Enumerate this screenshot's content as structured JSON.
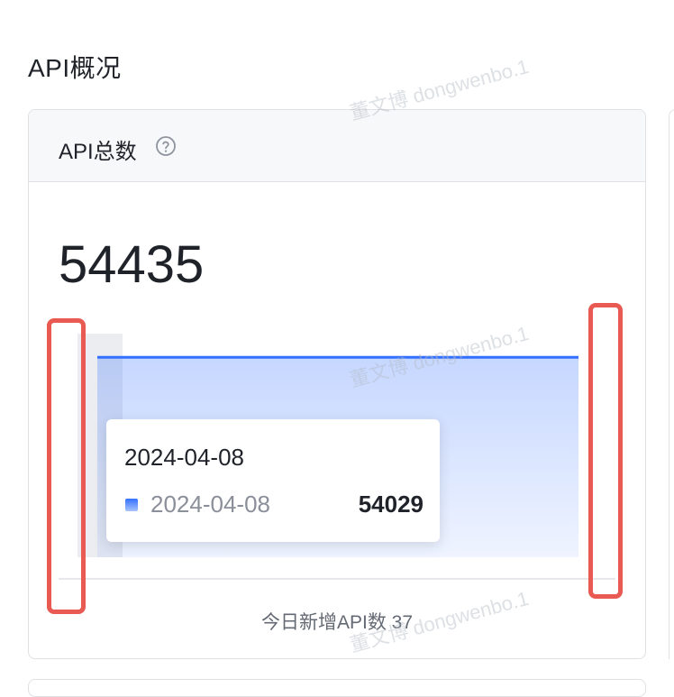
{
  "section": {
    "title": "API概况"
  },
  "card": {
    "title": "API总数",
    "help_icon": "question-circle-icon",
    "total": "54435",
    "footer": "今日新增API数 37"
  },
  "chart_data": {
    "type": "area",
    "x": [
      "2024-04-08"
    ],
    "series": [
      {
        "values": [
          54029
        ]
      }
    ],
    "color": "#3370ff",
    "grid": false
  },
  "tooltip": {
    "title": "2024-04-08",
    "label": "2024-04-08",
    "value": "54029"
  },
  "watermark": "董文博 dongwenbo.1",
  "annotation_color": "#e85a52"
}
